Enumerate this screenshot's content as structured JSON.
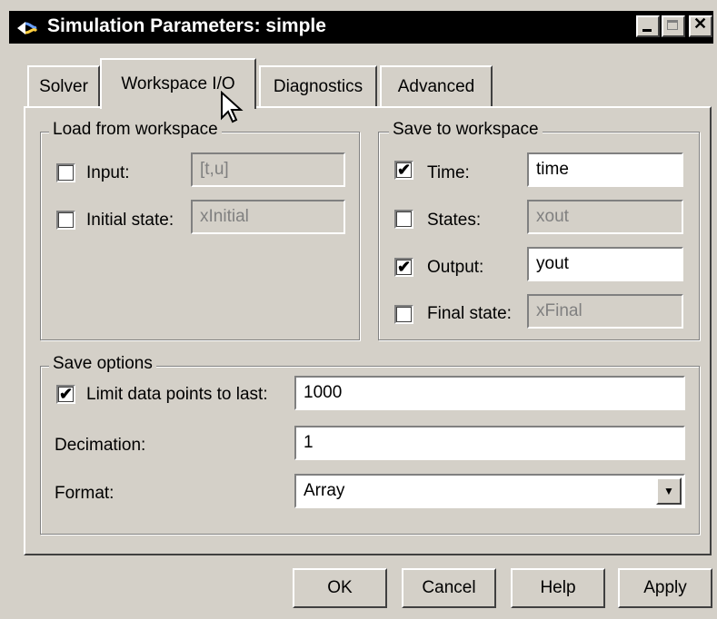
{
  "window": {
    "title": "Simulation Parameters: simple",
    "icon": "simulink-icon",
    "controls": {
      "minimize": "minimize-icon",
      "maximize": "maximize-icon",
      "close": "close-icon"
    }
  },
  "tabs": [
    {
      "label": "Solver"
    },
    {
      "label": "Workspace I/O",
      "active": true
    },
    {
      "label": "Diagnostics"
    },
    {
      "label": "Advanced"
    }
  ],
  "load_group": {
    "title": "Load from workspace",
    "input": {
      "label": "Input:",
      "checked": false,
      "value": "[t,u]"
    },
    "initial_state": {
      "label": "Initial state:",
      "checked": false,
      "value": "xInitial"
    }
  },
  "save_group": {
    "title": "Save to workspace",
    "time": {
      "label": "Time:",
      "checked": true,
      "value": "time"
    },
    "states": {
      "label": "States:",
      "checked": false,
      "value": "xout"
    },
    "output": {
      "label": "Output:",
      "checked": true,
      "value": "yout"
    },
    "final_state": {
      "label": "Final state:",
      "checked": false,
      "value": "xFinal"
    }
  },
  "save_options": {
    "title": "Save options",
    "limit": {
      "label": "Limit data points to last:",
      "checked": true,
      "value": "1000"
    },
    "decimation": {
      "label": "Decimation:",
      "value": "1"
    },
    "format": {
      "label": "Format:",
      "value": "Array"
    }
  },
  "buttons": {
    "ok": "OK",
    "cancel": "Cancel",
    "help": "Help",
    "apply": "Apply"
  },
  "check_glyph": "✔"
}
